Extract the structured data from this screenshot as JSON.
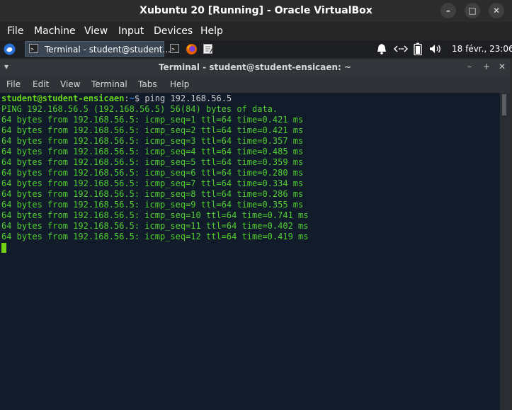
{
  "host": {
    "title": "Xubuntu 20 [Running] - Oracle VirtualBox",
    "buttons": {
      "minimize": "–",
      "maximize": "□",
      "close": "✕"
    },
    "menu": [
      "File",
      "Machine",
      "View",
      "Input",
      "Devices",
      "Help"
    ]
  },
  "panel": {
    "task_label": "Terminal - student@student...",
    "clock": "18 févr., 23:06"
  },
  "terminal": {
    "title": "Terminal - student@student-ensicaen: ~",
    "title_buttons": {
      "menu": "▾",
      "minimize": "–",
      "maximize": "+",
      "close": "✕"
    },
    "menu": [
      "File",
      "Edit",
      "View",
      "Terminal",
      "Tabs",
      "Help"
    ],
    "prompt": {
      "user": "student@student-ensicaen",
      "sep": ":",
      "path": "~",
      "symbol": "$",
      "command": " ping 192.168.56.5"
    },
    "lines": [
      "PING 192.168.56.5 (192.168.56.5) 56(84) bytes of data.",
      "64 bytes from 192.168.56.5: icmp_seq=1 ttl=64 time=0.421 ms",
      "64 bytes from 192.168.56.5: icmp_seq=2 ttl=64 time=0.421 ms",
      "64 bytes from 192.168.56.5: icmp_seq=3 ttl=64 time=0.357 ms",
      "64 bytes from 192.168.56.5: icmp_seq=4 ttl=64 time=0.485 ms",
      "64 bytes from 192.168.56.5: icmp_seq=5 ttl=64 time=0.359 ms",
      "64 bytes from 192.168.56.5: icmp_seq=6 ttl=64 time=0.280 ms",
      "64 bytes from 192.168.56.5: icmp_seq=7 ttl=64 time=0.334 ms",
      "64 bytes from 192.168.56.5: icmp_seq=8 ttl=64 time=0.286 ms",
      "64 bytes from 192.168.56.5: icmp_seq=9 ttl=64 time=0.355 ms",
      "64 bytes from 192.168.56.5: icmp_seq=10 ttl=64 time=0.741 ms",
      "64 bytes from 192.168.56.5: icmp_seq=11 ttl=64 time=0.402 ms",
      "64 bytes from 192.168.56.5: icmp_seq=12 ttl=64 time=0.419 ms"
    ]
  }
}
